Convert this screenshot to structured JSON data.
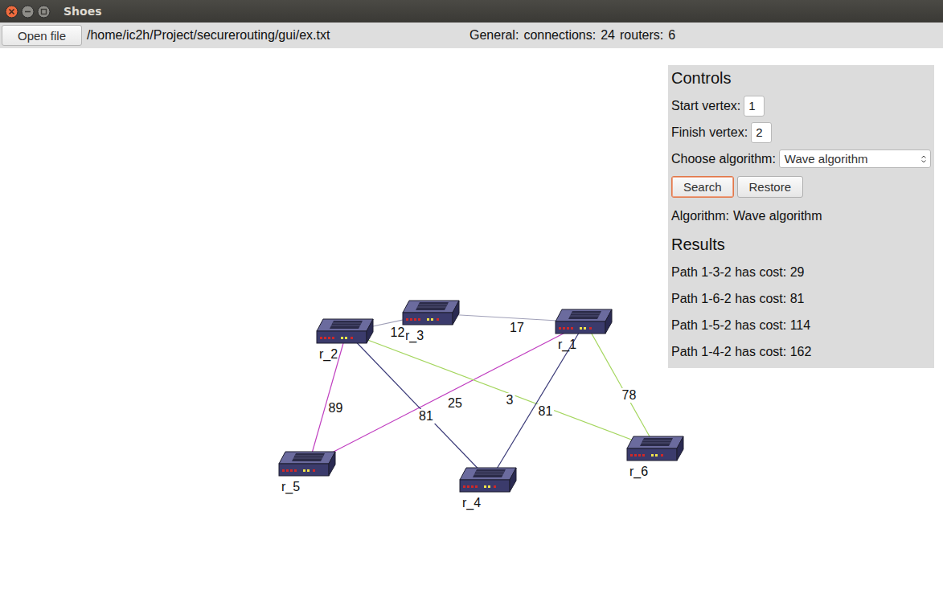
{
  "window": {
    "title": "Shoes"
  },
  "toolbar": {
    "open_button": "Open file",
    "path": "/home/ic2h/Project/securerouting/gui/ex.txt",
    "general": {
      "label": "General:",
      "connections_label": "connections:",
      "connections": "24",
      "routers_label": "routers:",
      "routers": "6"
    }
  },
  "graph": {
    "nodes": [
      {
        "name": "r_1"
      },
      {
        "name": "r_2"
      },
      {
        "name": "r_3"
      },
      {
        "name": "r_4"
      },
      {
        "name": "r_5"
      },
      {
        "name": "r_6"
      }
    ],
    "edges": [
      {
        "from": "r_2",
        "to": "r_3",
        "weight": "12",
        "color": "#a0a0b8"
      },
      {
        "from": "r_3",
        "to": "r_1",
        "weight": "17",
        "color": "#a0a0b8"
      },
      {
        "from": "r_2",
        "to": "r_5",
        "weight": "89",
        "color": "#c03ec0"
      },
      {
        "from": "r_1",
        "to": "r_5",
        "weight": "25",
        "color": "#c03ec0"
      },
      {
        "from": "r_2",
        "to": "r_4",
        "weight": "81",
        "color": "#3a3a78"
      },
      {
        "from": "r_2",
        "to": "r_6",
        "weight": "3",
        "color": "#a4d65e"
      },
      {
        "from": "r_1",
        "to": "r_4",
        "weight": "81",
        "color": "#3a3a78"
      },
      {
        "from": "r_1",
        "to": "r_6",
        "weight": "78",
        "color": "#a4d65e"
      }
    ]
  },
  "controls": {
    "title": "Controls",
    "start": {
      "label": "Start vertex:",
      "value": "1"
    },
    "finish": {
      "label": "Finish vertex:",
      "value": "2"
    },
    "algorithm": {
      "label": "Choose algorithm:",
      "value": "Wave algorithm"
    },
    "buttons": [
      {
        "label": "Search",
        "focused": true
      },
      {
        "label": "Restore",
        "focused": false
      }
    ],
    "status": {
      "label": "Algorithm:",
      "value": "Wave algorithm"
    }
  },
  "results": {
    "title": "Results",
    "items": [
      "Path 1-3-2 has cost: 29",
      "Path 1-6-2 has cost: 81",
      "Path 1-5-2 has cost: 114",
      "Path 1-4-2 has cost: 162"
    ]
  }
}
